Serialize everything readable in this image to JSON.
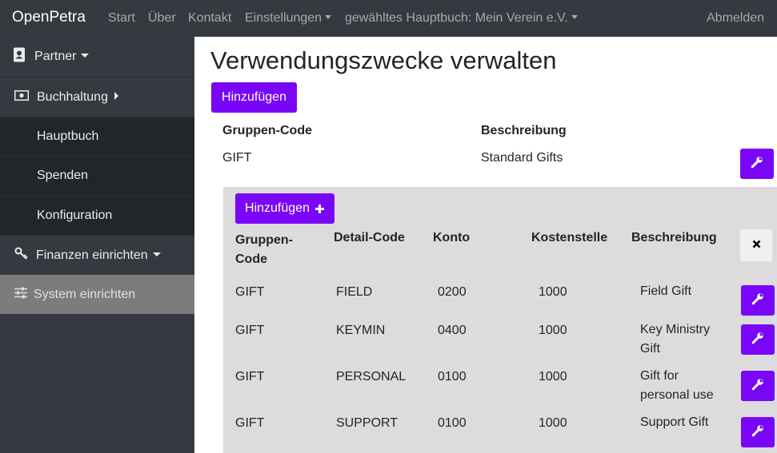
{
  "topbar": {
    "brand": "OpenPetra",
    "start": "Start",
    "ueber": "Über",
    "kontakt": "Kontakt",
    "einstellungen": "Einstellungen",
    "ledger": "gewähltes Hauptbuch: Mein Verein e.V.",
    "logout": "Abmelden"
  },
  "sidebar": {
    "partner": "Partner",
    "buchhaltung": "Buchhaltung",
    "hauptbuch": "Hauptbuch",
    "spenden": "Spenden",
    "konfiguration": "Konfiguration",
    "finanzen": "Finanzen einrichten",
    "system": "System einrichten"
  },
  "main": {
    "title": "Verwendungszwecke verwalten",
    "add_label": "Hinzufügen",
    "groups_header": {
      "code": "Gruppen-Code",
      "description": "Beschreibung"
    },
    "group": {
      "code": "GIFT",
      "description": "Standard Gifts"
    },
    "details": {
      "add_label": "Hinzufügen",
      "headers": {
        "group_code": "Gruppen-Code",
        "detail_code": "Detail-Code",
        "account": "Konto",
        "cost_centre": "Kostenstelle",
        "description": "Beschreibung"
      },
      "rows": [
        {
          "group_code": "GIFT",
          "detail_code": "FIELD",
          "account": "0200",
          "cost_centre": "1000",
          "description": "Field Gift"
        },
        {
          "group_code": "GIFT",
          "detail_code": "KEYMIN",
          "account": "0400",
          "cost_centre": "1000",
          "description": "Key Ministry Gift"
        },
        {
          "group_code": "GIFT",
          "detail_code": "PERSONAL",
          "account": "0100",
          "cost_centre": "1000",
          "description": "Gift for personal use"
        },
        {
          "group_code": "GIFT",
          "detail_code": "SUPPORT",
          "account": "0100",
          "cost_centre": "1000",
          "description": "Support Gift"
        }
      ]
    }
  },
  "colors": {
    "accent": "#7a06f8",
    "navbar": "#343a40",
    "submenu": "#232629",
    "active": "#7c7c7c",
    "panel": "#dcdcdc"
  }
}
